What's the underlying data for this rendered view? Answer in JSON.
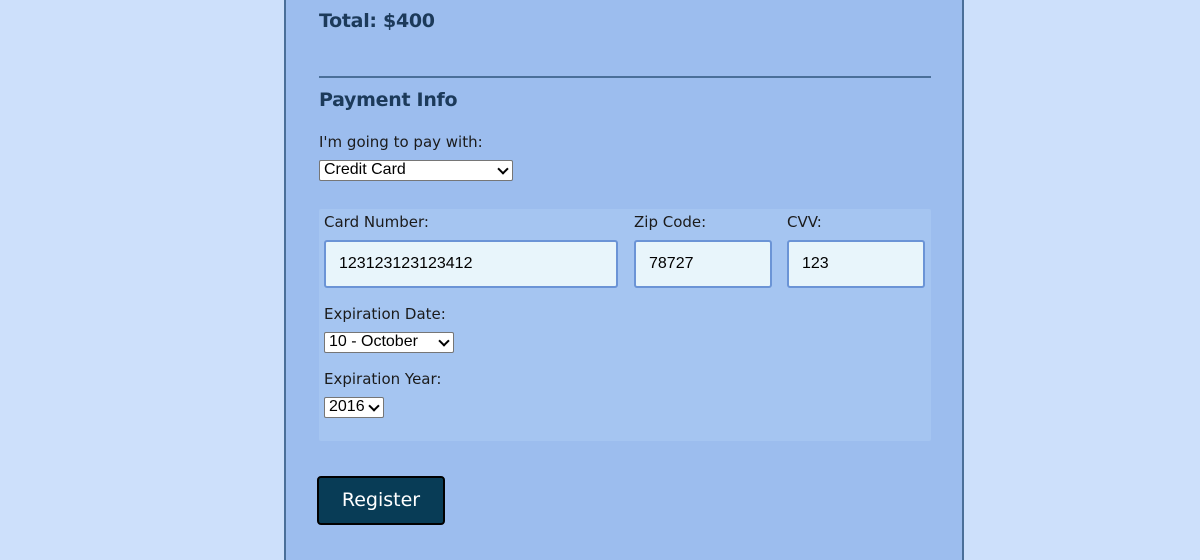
{
  "summary": {
    "total_text": "Total: $400"
  },
  "payment": {
    "section_title": "Payment Info",
    "pay_with_label": "I'm going to pay with:",
    "pay_with_value": "Credit Card"
  },
  "credit_card": {
    "card_number_label": "Card Number:",
    "card_number_value": "123123123123412",
    "zip_label": "Zip Code:",
    "zip_value": "78727",
    "cvv_label": "CVV:",
    "cvv_value": "123",
    "exp_date_label": "Expiration Date:",
    "exp_date_value": "10 - October",
    "exp_year_label": "Expiration Year:",
    "exp_year_value": "2016"
  },
  "actions": {
    "register_label": "Register"
  },
  "icons": {
    "dropdown": "chevron-down-icon"
  },
  "colors": {
    "page_background": "#cde0fb",
    "panel_background": "#9cbdee",
    "card_box_background": "#a5c5f1",
    "input_background": "#e8f5fb",
    "button_background": "#083c56",
    "heading_text": "#1c3a5a"
  }
}
